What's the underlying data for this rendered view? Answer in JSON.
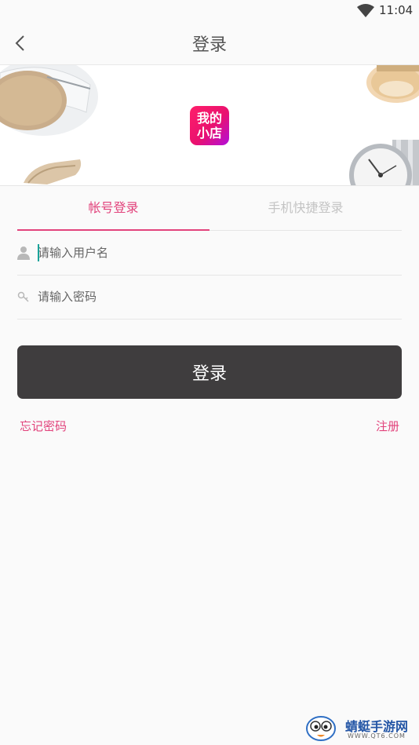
{
  "status_bar": {
    "time": "11:04"
  },
  "header": {
    "title": "登录"
  },
  "banner": {
    "logo_line1": "我的",
    "logo_line2": "小店"
  },
  "tabs": [
    {
      "label": "帐号登录",
      "active": true
    },
    {
      "label": "手机快捷登录",
      "active": false
    }
  ],
  "form": {
    "username": {
      "value": "",
      "placeholder": "请输入用户名"
    },
    "password": {
      "value": "",
      "placeholder": "请输入密码"
    }
  },
  "login_button": {
    "label": "登录"
  },
  "links": {
    "forgot_password": "忘记密码",
    "register": "注册"
  },
  "watermark": {
    "text": "蜻蜓手游网",
    "url": "WWW.QT6.COM"
  },
  "colors": {
    "accent": "#e2437c",
    "button_bg": "#3f3d3e",
    "inactive_tab": "#c4c4c4"
  }
}
